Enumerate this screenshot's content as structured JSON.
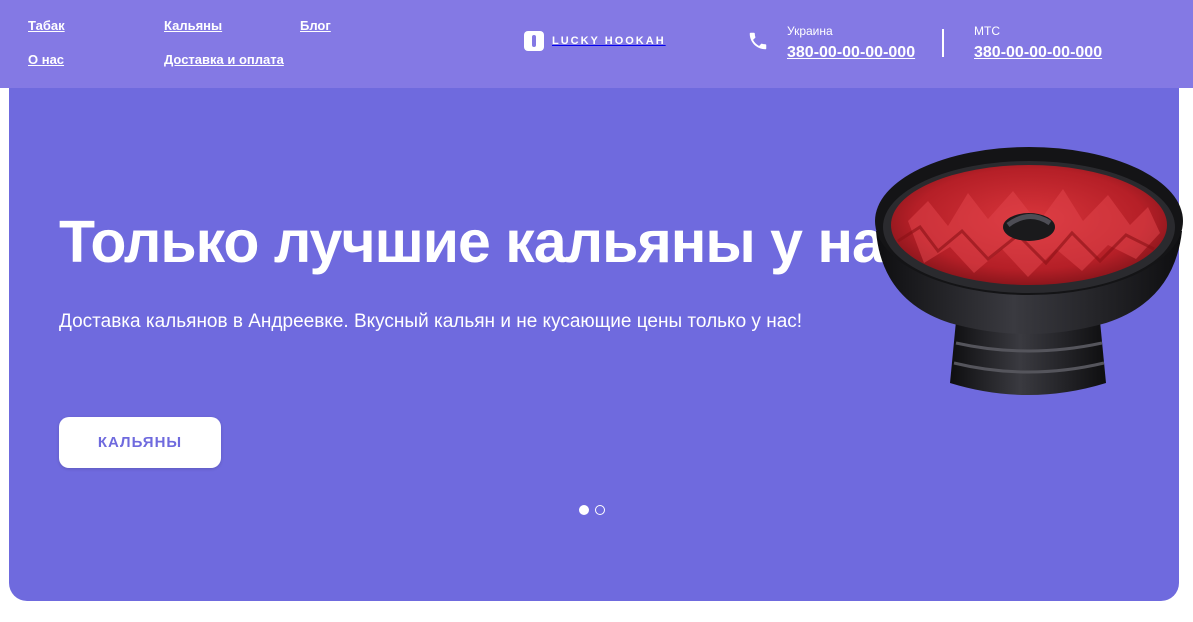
{
  "nav": {
    "tobacco": "Табак",
    "hookahs": "Кальяны",
    "blog": "Блог",
    "about": "О нас",
    "delivery": "Доставка и оплата"
  },
  "logo": {
    "text": "LUCKY HOOKAH"
  },
  "contacts": [
    {
      "label": "Украина",
      "number": "380-00-00-00-000"
    },
    {
      "label": "МТС",
      "number": "380-00-00-00-000"
    }
  ],
  "hero": {
    "title": "Только лучшие кальяны у нас",
    "subtitle": "Доставка кальянов в Андреевке. Вкусный кальян и не кусающие цены только у нас!",
    "button": "КАЛЬЯНЫ",
    "slides_total": 2,
    "active_slide": 1
  },
  "icons": {
    "phone": "phone-icon",
    "logo": "hookah-logo-icon",
    "hero_image": "hookah-bowl-image"
  },
  "colors": {
    "header": "#8479e4",
    "hero": "#6f6ade",
    "button_text": "#6f6ade"
  }
}
